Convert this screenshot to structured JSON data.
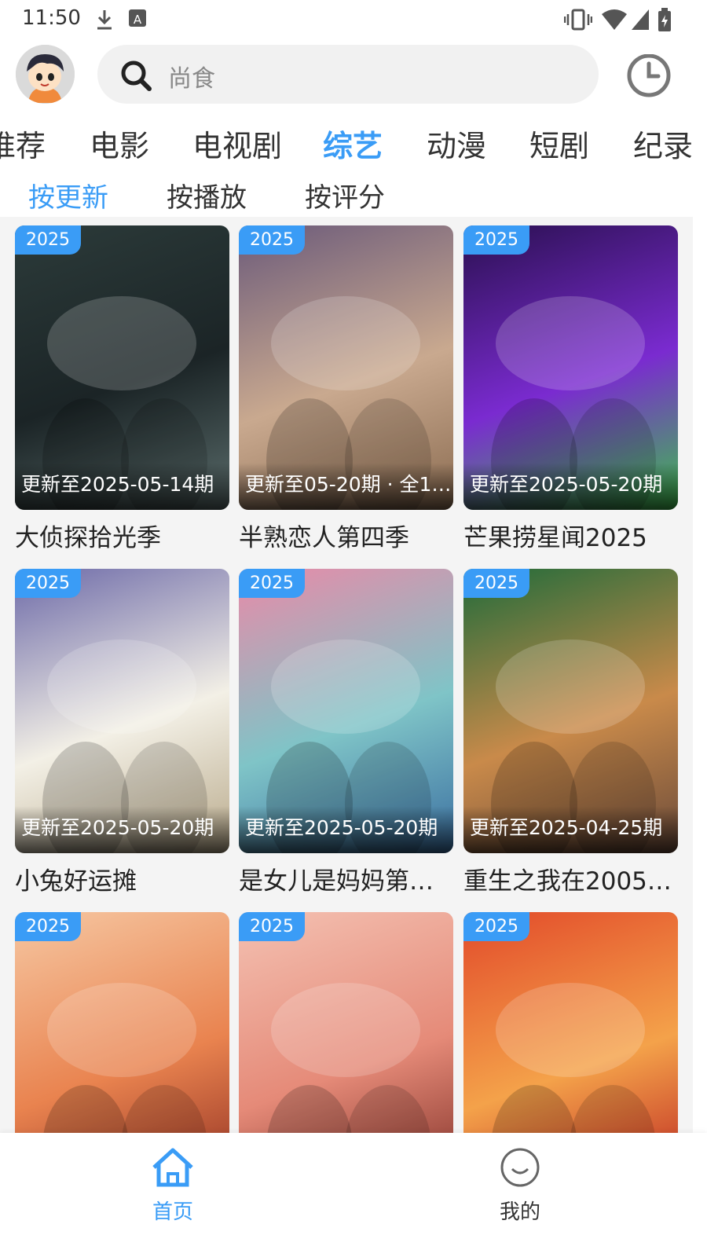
{
  "status_bar": {
    "time": "11:50",
    "icons": [
      "download-icon",
      "a-box-icon",
      "vibrate-icon",
      "wifi-icon",
      "signal-icon",
      "battery-icon"
    ]
  },
  "header": {
    "search_placeholder": "尚食",
    "avatar_icon": "cartoon-avatar",
    "history_icon": "clock-icon"
  },
  "categories": [
    {
      "label": "推荐"
    },
    {
      "label": "电影"
    },
    {
      "label": "电视剧"
    },
    {
      "label": "综艺"
    },
    {
      "label": "动漫"
    },
    {
      "label": "短剧"
    },
    {
      "label": "纪录"
    }
  ],
  "active_category": "综艺",
  "sort_tabs": [
    {
      "label": "按更新"
    },
    {
      "label": "按播放"
    },
    {
      "label": "按评分"
    }
  ],
  "active_sort": "按更新",
  "items": [
    {
      "year": "2025",
      "update": "更新至2025-05-14期",
      "title": "大侦探拾光季",
      "colors": [
        "#2c3b3a",
        "#1b2426",
        "#5b6d6c"
      ]
    },
    {
      "year": "2025",
      "update": "更新至05-20期 · 全1…",
      "title": "半熟恋人第四季",
      "colors": [
        "#6b5a7a",
        "#c9a98f",
        "#8a6b50"
      ]
    },
    {
      "year": "2025",
      "update": "更新至2025-05-20期",
      "title": "芒果捞星闻2025",
      "colors": [
        "#2a1050",
        "#7a2bd0",
        "#3ec04a"
      ]
    },
    {
      "year": "2025",
      "update": "更新至2025-05-20期",
      "title": "小兔好运摊",
      "colors": [
        "#6d6aa8",
        "#f3f0e6",
        "#b8a98a"
      ]
    },
    {
      "year": "2025",
      "update": "更新至2025-05-20期",
      "title": "是女儿是妈妈第…",
      "colors": [
        "#e98aa8",
        "#7fc4c7",
        "#3a6ea0"
      ]
    },
    {
      "year": "2025",
      "update": "更新至2025-04-25期",
      "title": "重生之我在2005…",
      "colors": [
        "#1f6b3a",
        "#c98a4a",
        "#6a4a3a"
      ]
    },
    {
      "year": "2025",
      "update": "",
      "title": "",
      "colors": [
        "#f6c7a2",
        "#e9834f",
        "#8b2a1f"
      ]
    },
    {
      "year": "2025",
      "update": "",
      "title": "",
      "colors": [
        "#f4c1b2",
        "#e58a78",
        "#7a2a22"
      ]
    },
    {
      "year": "2025",
      "update": "",
      "title": "",
      "colors": [
        "#e24a2a",
        "#f4a24a",
        "#b81e1e"
      ]
    }
  ],
  "bottom_nav": [
    {
      "label": "首页",
      "icon": "home-icon"
    },
    {
      "label": "我的",
      "icon": "smile-face-icon"
    }
  ],
  "active_nav": "首页",
  "accent_color": "#3a9cf6"
}
